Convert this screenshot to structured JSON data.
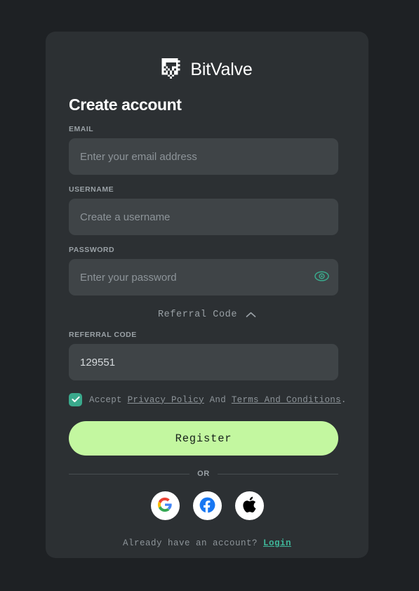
{
  "brand": {
    "name": "BitValve",
    "logo_icon": "bitvalve-pixel-mark"
  },
  "heading": "Create account",
  "form": {
    "email": {
      "label": "EMAIL",
      "placeholder": "Enter your email address",
      "value": ""
    },
    "username": {
      "label": "USERNAME",
      "placeholder": "Create a username",
      "value": ""
    },
    "password": {
      "label": "PASSWORD",
      "placeholder": "Enter your password",
      "value": "",
      "toggle_icon": "eye-icon"
    },
    "referral_toggle": {
      "label": "Referral Code",
      "icon": "chevron-up-icon",
      "expanded": true
    },
    "referral_code": {
      "label": "REFERRAL CODE",
      "placeholder": "",
      "value": "129551"
    }
  },
  "accept": {
    "checked": true,
    "check_icon": "checkmark-icon",
    "prefix": "Accept ",
    "privacy_link": "Privacy Policy",
    "middle": " And ",
    "terms_link": "Terms And Conditions",
    "suffix": "."
  },
  "register_button": "Register",
  "divider_label": "OR",
  "socials": [
    {
      "name": "google",
      "label": "Google"
    },
    {
      "name": "facebook",
      "label": "Facebook"
    },
    {
      "name": "apple",
      "label": "Apple"
    }
  ],
  "footer": {
    "text": "Already have an account? ",
    "link": "Login"
  },
  "colors": {
    "page_background": "#1e2124",
    "card_background": "#2c3033",
    "input_background": "#3f4447",
    "accent_green": "#c3f7a0",
    "accent_teal": "#3aa98c",
    "link_teal": "#3fb79a",
    "label_gray": "#9aa1a6",
    "placeholder_gray": "#8d9499"
  }
}
